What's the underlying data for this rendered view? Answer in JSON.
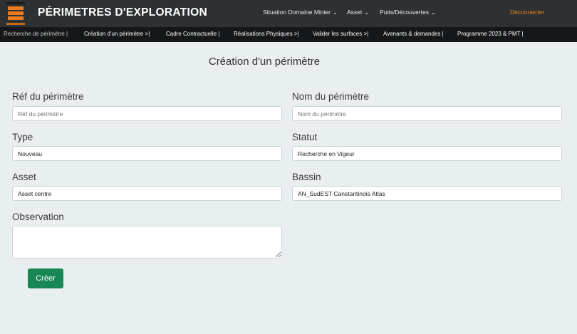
{
  "header": {
    "logo_icon": "orange-stacked-logo-icon",
    "title": "PÉRIMETRES D'EXPLORATION",
    "nav": [
      {
        "label": "Situation Domaine Minier",
        "chevron": "chevron-down-icon"
      },
      {
        "label": "Asset",
        "chevron": "chevron-down-icon"
      },
      {
        "label": "Puits/Découvertes",
        "chevron": "chevron-down-icon"
      }
    ],
    "logout_label": "Déconnecter",
    "logout_color": "#f0801e"
  },
  "subnav": [
    "Recherche de périmètre |",
    "Création d'un périmètre >|",
    "Cadre Contractuelle |",
    "Réalisations Physiques >|",
    "Valider les surfaces >|",
    "Avenants & demandes |",
    "Programme 2023 & PMT |"
  ],
  "form": {
    "title": "Création d'un périmètre",
    "ref": {
      "label": "Réf du périmètre",
      "placeholder": "Réf du périmètre",
      "value": ""
    },
    "nom": {
      "label": "Nom du périmètre",
      "placeholder": "Nom du périmètre",
      "value": ""
    },
    "type": {
      "label": "Type",
      "value": "Nouveau"
    },
    "statut": {
      "label": "Statut",
      "value": "Recherche en Vigeur"
    },
    "asset": {
      "label": "Asset",
      "value": "Asset centre"
    },
    "bassin": {
      "label": "Bassin",
      "value": "AN_SudEST Canstantinois Atlas"
    },
    "observation": {
      "label": "Observation",
      "value": ""
    },
    "submit_label": "Créer",
    "submit_color": "#198754"
  }
}
